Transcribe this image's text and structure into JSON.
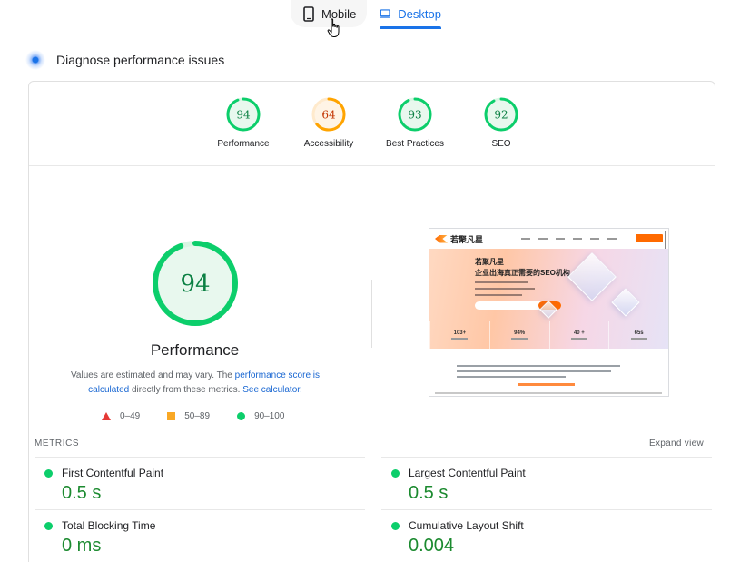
{
  "device_tabs": {
    "mobile_label": "Mobile",
    "desktop_label": "Desktop",
    "selected": "Desktop"
  },
  "diagnose_heading": "Diagnose performance issues",
  "categories": [
    {
      "score": "94",
      "label": "Performance",
      "value": 94,
      "color": "#0cce6b"
    },
    {
      "score": "64",
      "label": "Accessibility",
      "value": 64,
      "color": "#ffa400"
    },
    {
      "score": "93",
      "label": "Best Practices",
      "value": 93,
      "color": "#0cce6b"
    },
    {
      "score": "92",
      "label": "SEO",
      "value": 92,
      "color": "#0cce6b"
    }
  ],
  "performance": {
    "score": "94",
    "value": 94,
    "title": "Performance",
    "desc_prefix": "Values are estimated and may vary. The ",
    "desc_link1": "performance score is calculated",
    "desc_mid": " directly from these metrics. ",
    "desc_link2": "See calculator."
  },
  "legend": {
    "fail": "0–49",
    "average": "50–89",
    "pass": "90–100"
  },
  "screenshot_preview": {
    "site_name": "若聚凡星",
    "hero_line1": "若聚凡星",
    "hero_line2": "企业出海真正需要的SEO机构",
    "stats": [
      "103+",
      "94%",
      "40 +",
      "65s"
    ]
  },
  "metrics": {
    "header": "METRICS",
    "expand_label": "Expand view",
    "items": [
      {
        "name": "First Contentful Paint",
        "value": "0.5 s"
      },
      {
        "name": "Largest Contentful Paint",
        "value": "0.5 s"
      },
      {
        "name": "Total Blocking Time",
        "value": "0 ms"
      },
      {
        "name": "Cumulative Layout Shift",
        "value": "0.004"
      }
    ]
  },
  "colors": {
    "pass": "#0cce6b",
    "average": "#ffa400",
    "fail": "#ff4e42",
    "accent": "#1a73e8"
  }
}
